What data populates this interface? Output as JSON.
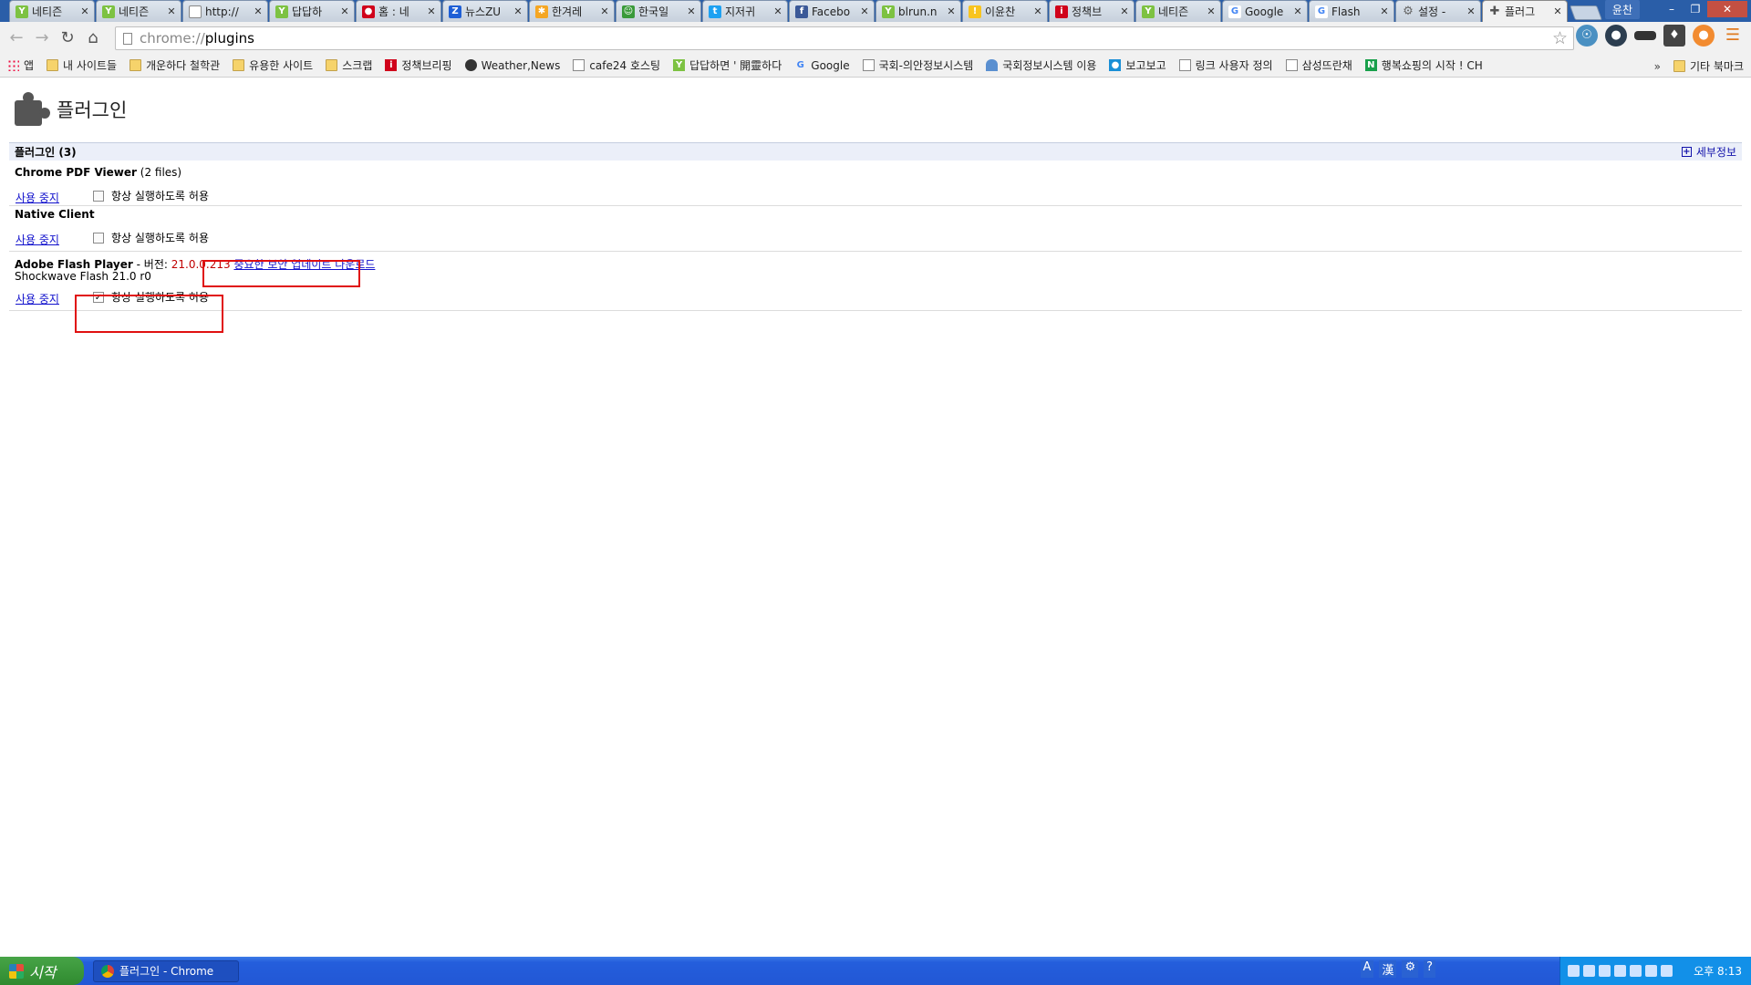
{
  "tabs": [
    {
      "title": "네티즌",
      "icon": "naver-sprout-icon",
      "color": "#7dc242"
    },
    {
      "title": "네티즌",
      "icon": "naver-sprout-icon",
      "color": "#7dc242"
    },
    {
      "title": "http://",
      "icon": "page-icon",
      "color": "#ffffff"
    },
    {
      "title": "답답하",
      "icon": "naver-sprout-icon",
      "color": "#7dc242"
    },
    {
      "title": "홈 : 네",
      "icon": "red-gem-icon",
      "color": "#d0021b"
    },
    {
      "title": "뉴스ZU",
      "icon": "z-icon",
      "color": "#1e5fd6"
    },
    {
      "title": "한겨레",
      "icon": "pinwheel-icon",
      "color": "#f5a623"
    },
    {
      "title": "한국일",
      "icon": "person-icon",
      "color": "#3a9a3a"
    },
    {
      "title": "지저귀",
      "icon": "twitter-bird-icon",
      "color": "#1da1f2"
    },
    {
      "title": "Facebo",
      "icon": "facebook-icon",
      "color": "#3b5998"
    },
    {
      "title": "blrun.n",
      "icon": "naver-sprout-icon",
      "color": "#7dc242"
    },
    {
      "title": "이윤찬",
      "icon": "yellow-icon",
      "color": "#f8c41f"
    },
    {
      "title": "정책브",
      "icon": "red-i-icon",
      "color": "#d0021b"
    },
    {
      "title": "네티즌",
      "icon": "naver-sprout-icon",
      "color": "#7dc242"
    },
    {
      "title": "Google",
      "icon": "google-g-icon",
      "color": "#4285f4"
    },
    {
      "title": "Flash",
      "icon": "google-g-icon",
      "color": "#4285f4"
    },
    {
      "title": "설정 -",
      "icon": "gear-icon",
      "color": "#666666"
    },
    {
      "title": "플러그",
      "icon": "puzzle-icon",
      "color": "#555555",
      "active": true
    }
  ],
  "window": {
    "user": "윤찬"
  },
  "omnibox": {
    "scheme": "chrome://",
    "path": "plugins"
  },
  "bookmarks": [
    {
      "label": "앱",
      "icon": "apps-grid-icon"
    },
    {
      "label": "내 사이트들",
      "icon": "folder-icon"
    },
    {
      "label": "개운하다 철학관",
      "icon": "folder-icon"
    },
    {
      "label": "유용한 사이트",
      "icon": "folder-icon"
    },
    {
      "label": "스크랩",
      "icon": "folder-icon"
    },
    {
      "label": "정책브리핑",
      "icon": "red-i-icon"
    },
    {
      "label": "Weather,News",
      "icon": "weather-icon"
    },
    {
      "label": "cafe24 호스팅",
      "icon": "page-icon"
    },
    {
      "label": "답답하면 ' 開靈하다",
      "icon": "naver-sprout-icon"
    },
    {
      "label": "Google",
      "icon": "google-g-icon"
    },
    {
      "label": "국회-의안정보시스템",
      "icon": "page-icon"
    },
    {
      "label": "국회정보시스템 이용",
      "icon": "assembly-icon"
    },
    {
      "label": "보고보고",
      "icon": "blue-square-icon"
    },
    {
      "label": "링크 사용자 정의",
      "icon": "page-icon"
    },
    {
      "label": "삼성뜨란채",
      "icon": "page-icon"
    },
    {
      "label": "행복쇼핑의 시작 ! CH",
      "icon": "green-n-icon"
    }
  ],
  "bookmarks_other": "기타 북마크",
  "page": {
    "title": "플러그인",
    "section_title": "플러그인 (3)",
    "details_label": "세부정보"
  },
  "plugins": [
    {
      "name": "Chrome PDF Viewer",
      "extra": "(2 files)",
      "disable_label": "사용 중지",
      "allow_label": "항상 실행하도록 허용",
      "always_allowed": false
    },
    {
      "name": "Native Client",
      "extra": "",
      "disable_label": "사용 중지",
      "allow_label": "항상 실행하도록 허용",
      "always_allowed": false
    },
    {
      "name": "Adobe Flash Player",
      "version_prefix": " - 버전: ",
      "version": "21.0.0.213",
      "update_link": "중요한 보안 업데이트 다운로드",
      "subtitle": "Shockwave Flash 21.0 r0",
      "disable_label": "사용 중지",
      "allow_label": "항상 실행하도록 허용",
      "always_allowed": true
    }
  ],
  "taskbar": {
    "start_label": "시작",
    "window_item": "플러그인 - Chrome",
    "ime": [
      "A",
      "漢"
    ],
    "clock": "오후 8:13"
  }
}
